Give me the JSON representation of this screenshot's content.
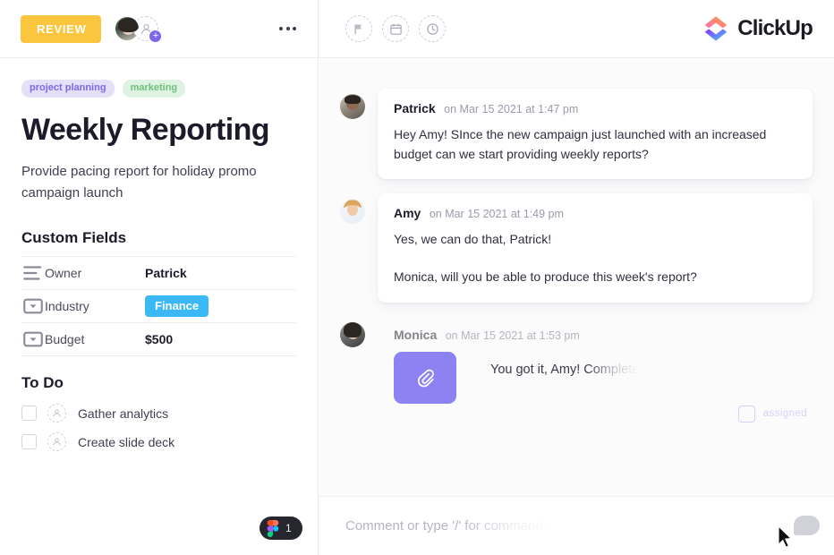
{
  "left": {
    "status_badge": "REVIEW",
    "add_person_icon": "add-person-icon",
    "more_menu_icon": "more-options-icon",
    "tags": [
      {
        "label": "project planning",
        "color": "#7b68ee",
        "bg": "#e3e0f8"
      },
      {
        "label": "marketing",
        "color": "#6fbf7f",
        "bg": "#dff3e2"
      }
    ],
    "title": "Weekly Reporting",
    "description": "Provide pacing report for holiday promo campaign launch",
    "custom_fields_heading": "Custom Fields",
    "custom_fields": [
      {
        "icon": "text-field-icon",
        "label": "Owner",
        "value": "Patrick",
        "type": "text"
      },
      {
        "icon": "dropdown-field-icon",
        "label": "Industry",
        "value": "Finance",
        "type": "chip",
        "chip_color": "#3bb9f5"
      },
      {
        "icon": "dropdown-field-icon",
        "label": "Budget",
        "value": "$500",
        "type": "text"
      }
    ],
    "todo_heading": "To Do",
    "todos": [
      {
        "label": "Gather analytics",
        "checked": false
      },
      {
        "label": "Create slide deck",
        "checked": false
      }
    ],
    "figma_badge_count": "1"
  },
  "right": {
    "toolbar_icons": [
      "flag-icon",
      "calendar-icon",
      "clock-icon"
    ],
    "brand_name": "ClickUp",
    "brand_colors": {
      "top": "#FD71AF",
      "top2": "#FF9A3E",
      "bottom": "#8930FD",
      "bottom2": "#49CCF9"
    },
    "comments": [
      {
        "author": "Patrick",
        "timestamp": "on Mar 15 2021 at 1:47 pm",
        "avatar": "avatar-patrick",
        "paragraphs": [
          "Hey Amy! SInce the new campaign just launched with an increased budget can we start providing weekly reports?"
        ]
      },
      {
        "author": "Amy",
        "timestamp": "on Mar 15 2021 at 1:49 pm",
        "avatar": "avatar-amy",
        "paragraphs": [
          "Yes, we can do that, Patrick!",
          "Monica, will you be able to produce this week's report?"
        ]
      }
    ],
    "pending_comment": {
      "author": "Monica",
      "timestamp": "on Mar 15 2021 at 1:53 pm",
      "avatar": "avatar-monica",
      "attachment_icon": "paperclip-icon",
      "attachment_color": "#8d82f2",
      "text": "You got it, Amy! Completed",
      "assigned_label": "assigned"
    },
    "composer_placeholder": "Comment or type '/' for commands"
  }
}
